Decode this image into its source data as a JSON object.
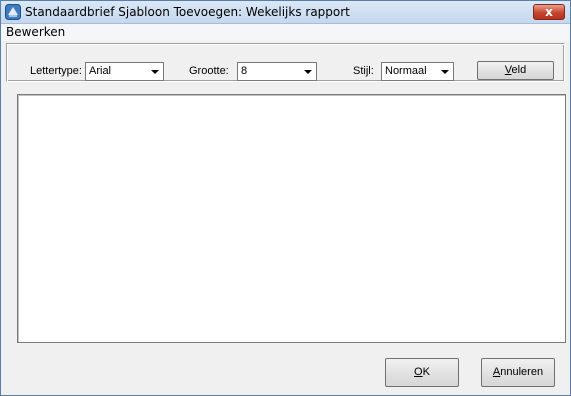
{
  "window": {
    "title": "Standaardbrief Sjabloon Toevoegen: Wekelijks rapport",
    "close_label": "x"
  },
  "menu": {
    "items": [
      {
        "label": "Bewerken"
      }
    ]
  },
  "toolbar": {
    "font_label": "Lettertype:",
    "font_value": "Arial",
    "size_label": "Grootte:",
    "size_value": "8",
    "style_label": "Stijl:",
    "style_value": "Normaal",
    "field_button_prefix": "",
    "field_button_mnemonic": "V",
    "field_button_rest": "eld"
  },
  "editor": {
    "content": ""
  },
  "buttons": {
    "ok_mnemonic": "O",
    "ok_rest": "K",
    "cancel_mnemonic": "A",
    "cancel_rest": "nnuleren"
  },
  "icons": {
    "app": "app-logo-icon",
    "close": "close-icon",
    "dropdown": "chevron-down-icon"
  }
}
